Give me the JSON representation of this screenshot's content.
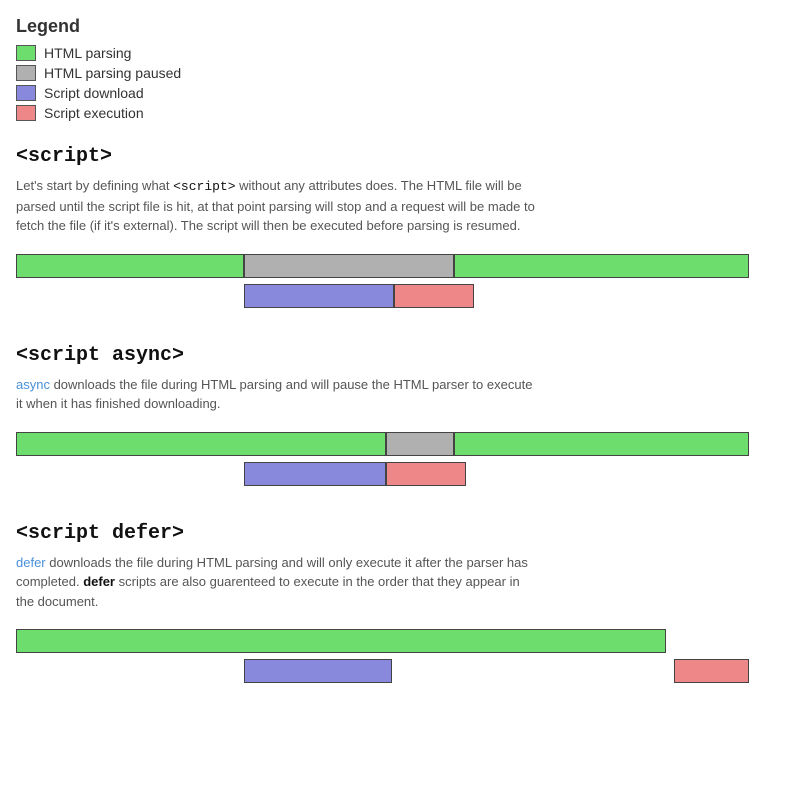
{
  "legend": {
    "title": "Legend",
    "items": [
      {
        "label": "HTML parsing",
        "color": "green"
      },
      {
        "label": "HTML parsing paused",
        "color": "gray"
      },
      {
        "label": "Script download",
        "color": "blue"
      },
      {
        "label": "Script execution",
        "color": "pink"
      }
    ]
  },
  "sections": [
    {
      "id": "script",
      "title": "<script>",
      "desc_parts": [
        {
          "text": "Let's start by defining what ",
          "style": "normal"
        },
        {
          "text": "<script>",
          "style": "code"
        },
        {
          "text": " without any attributes does. The HTML file will be parsed until the script file is hit, at that point parsing will stop and a request will be made to fetch the file (if it's external). The script will then be executed before parsing is resumed.",
          "style": "normal"
        }
      ]
    },
    {
      "id": "script-async",
      "title": "<script async>",
      "desc_parts": [
        {
          "text": "async",
          "style": "highlight"
        },
        {
          "text": " downloads the file during HTML parsing and will pause the HTML parser to execute it when it has finished downloading.",
          "style": "normal"
        }
      ]
    },
    {
      "id": "script-defer",
      "title": "<script defer>",
      "desc_parts": [
        {
          "text": "defer",
          "style": "highlight"
        },
        {
          "text": " downloads the file during HTML parsing and will only execute it after the parser has completed. ",
          "style": "normal"
        },
        {
          "text": "defer",
          "style": "code-bold"
        },
        {
          "text": " scripts are also guarenteed to execute in the order that they appear in the document.",
          "style": "normal"
        }
      ]
    }
  ]
}
